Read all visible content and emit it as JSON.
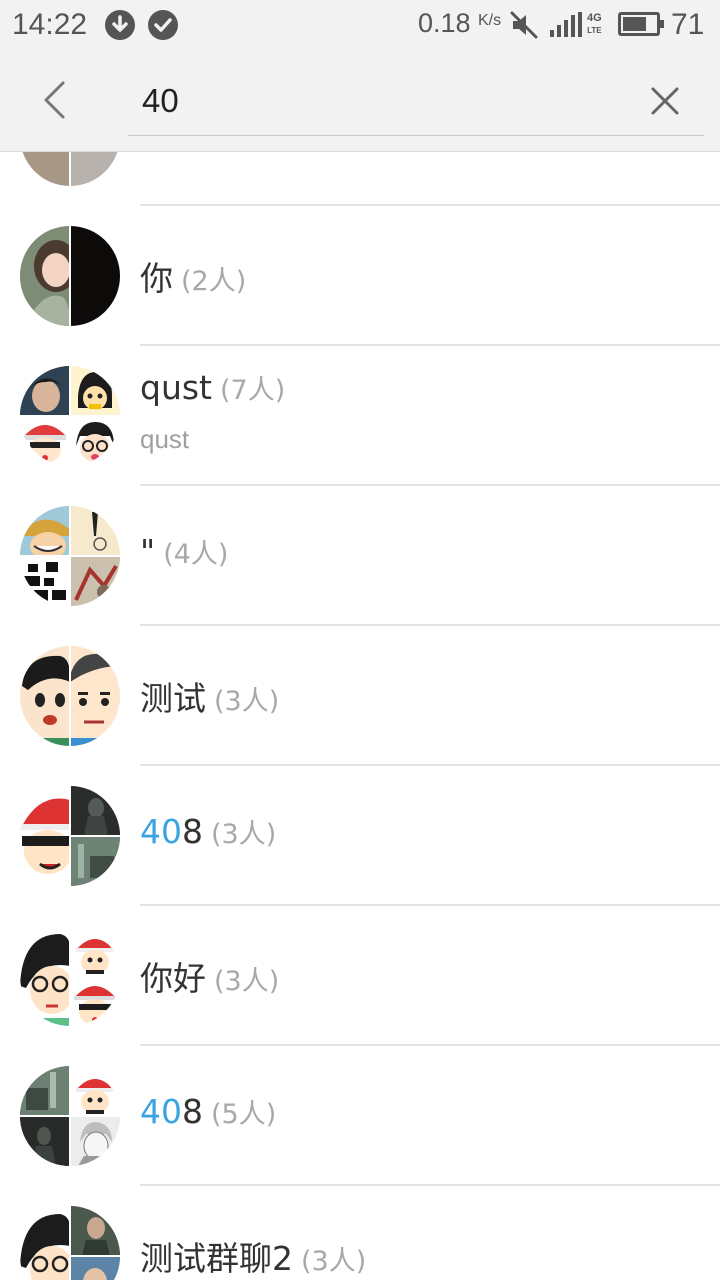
{
  "status_bar": {
    "time": "14:22",
    "net_speed": "0.18",
    "net_speed_unit": "K/s",
    "network_type_top": "4G",
    "network_type_bottom": "LTE",
    "battery_percent": "71",
    "battery_level": 0.71,
    "icons": [
      "download-icon",
      "check-icon",
      "mute-icon",
      "signal-icon",
      "battery-icon"
    ]
  },
  "search": {
    "query": "40",
    "back_icon": "back-chevron-icon",
    "clear_icon": "close-icon"
  },
  "colors": {
    "highlight": "#3aa4e0",
    "count": "#a8a8a8",
    "header_bg": "#f2f2f2",
    "divider": "#e4e4e4"
  },
  "results": [
    {
      "name": "",
      "count": ""
    },
    {
      "name": "你",
      "count": "(2人)"
    },
    {
      "name": "qust",
      "count": "(7人)",
      "subtitle": "qust"
    },
    {
      "name": "\"",
      "count": "(4人)"
    },
    {
      "name": "测试",
      "count": "(3人)"
    },
    {
      "name_highlight": "40",
      "name_rest": "8",
      "count": "(3人)"
    },
    {
      "name": "你好",
      "count": "(3人)"
    },
    {
      "name_highlight": "40",
      "name_rest": "8",
      "count": "(5人)"
    },
    {
      "name": "测试群聊2",
      "count": "(3人)"
    }
  ]
}
